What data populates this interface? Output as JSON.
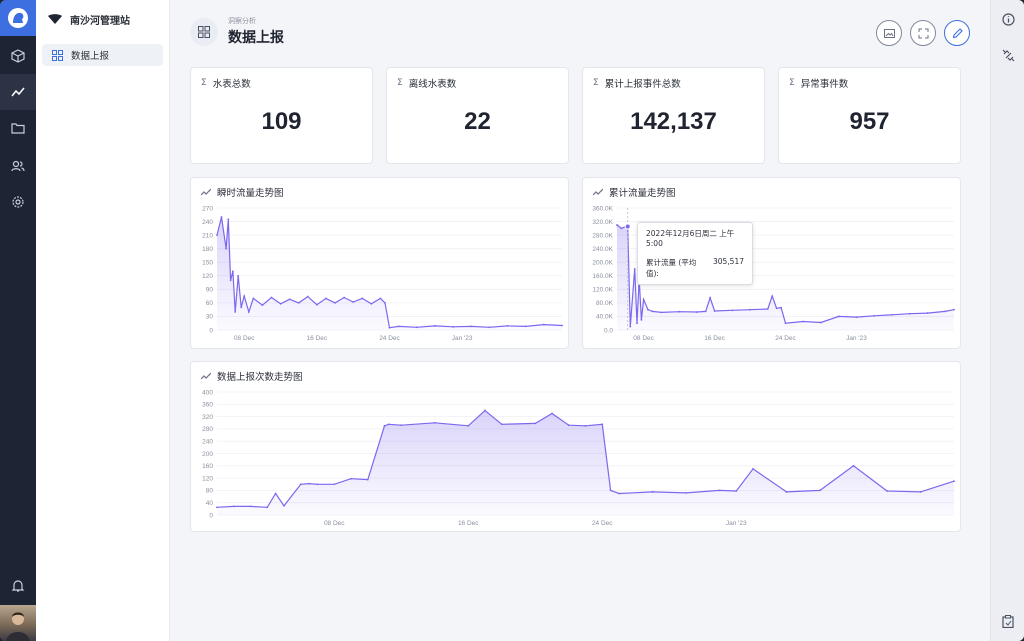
{
  "sidebar": {
    "site_name": "南沙河管理站",
    "items": [
      {
        "label": "数据上报"
      }
    ]
  },
  "header": {
    "breadcrumb": "洞察分析",
    "title": "数据上报"
  },
  "stats": [
    {
      "label": "水表总数",
      "value": "109"
    },
    {
      "label": "离线水表数",
      "value": "22"
    },
    {
      "label": "累计上报事件总数",
      "value": "142,137"
    },
    {
      "label": "异常事件数",
      "value": "957"
    }
  ],
  "colors": {
    "accent": "#7b68ee",
    "brand": "#3d6fe0",
    "rail": "#1d2433"
  },
  "tooltip": {
    "date": "2022年12月6日周二 上午5:00",
    "series": "累计流量 (平均值):",
    "value": "305,517"
  },
  "chart_data": [
    {
      "type": "area",
      "title": "瞬时流量走势图",
      "y_ticks": [
        "270",
        "240",
        "210",
        "180",
        "150",
        "120",
        "90",
        "60",
        "30",
        "0"
      ],
      "x_ticks": [
        "08 Dec",
        "16 Dec",
        "24 Dec",
        "Jan '23"
      ],
      "ylim": [
        0,
        270
      ],
      "x_range": [
        "2022-12-05",
        "2023-01-12"
      ],
      "x_tick_dates": [
        "2022-12-08",
        "2022-12-16",
        "2022-12-24",
        "2023-01-01"
      ],
      "x": [
        "2022-12-05",
        "2022-12-05T12:00",
        "2022-12-06",
        "2022-12-06T06:00",
        "2022-12-06T12:00",
        "2022-12-06T18:00",
        "2022-12-07",
        "2022-12-07T08:00",
        "2022-12-07T16:00",
        "2022-12-08",
        "2022-12-08T12:00",
        "2022-12-09",
        "2022-12-10",
        "2022-12-11",
        "2022-12-12",
        "2022-12-13",
        "2022-12-14",
        "2022-12-15",
        "2022-12-16",
        "2022-12-17",
        "2022-12-18",
        "2022-12-19",
        "2022-12-20",
        "2022-12-21",
        "2022-12-22",
        "2022-12-23",
        "2022-12-23T12:00",
        "2022-12-24",
        "2022-12-25",
        "2022-12-27",
        "2022-12-29",
        "2022-12-31",
        "2023-01-02",
        "2023-01-04",
        "2023-01-06",
        "2023-01-08",
        "2023-01-10",
        "2023-01-12"
      ],
      "values": [
        210,
        250,
        180,
        245,
        110,
        130,
        40,
        120,
        50,
        75,
        40,
        70,
        55,
        72,
        58,
        68,
        60,
        74,
        56,
        70,
        60,
        72,
        62,
        70,
        58,
        70,
        60,
        5,
        8,
        6,
        9,
        7,
        8,
        6,
        9,
        8,
        12,
        10
      ]
    },
    {
      "type": "area",
      "title": "累计流量走势图",
      "y_ticks": [
        "360.0K",
        "320.0K",
        "280.0K",
        "240.0K",
        "200.0K",
        "160.0K",
        "120.0K",
        "80.0K",
        "40.0K",
        "0.0"
      ],
      "x_ticks": [
        "08 Dec",
        "16 Dec",
        "24 Dec",
        "Jan '23"
      ],
      "ylim": [
        0,
        360000
      ],
      "x_range": [
        "2022-12-05",
        "2023-01-12"
      ],
      "x_tick_dates": [
        "2022-12-08",
        "2022-12-16",
        "2022-12-24",
        "2023-01-01"
      ],
      "x": [
        "2022-12-05",
        "2022-12-05T12:00",
        "2022-12-06",
        "2022-12-06T05:00",
        "2022-12-06T12:00",
        "2022-12-07",
        "2022-12-07T06:00",
        "2022-12-07T12:00",
        "2022-12-07T18:00",
        "2022-12-08",
        "2022-12-08T12:00",
        "2022-12-09",
        "2022-12-10",
        "2022-12-12",
        "2022-12-14",
        "2022-12-15",
        "2022-12-15T12:00",
        "2022-12-16",
        "2022-12-18",
        "2022-12-20",
        "2022-12-22",
        "2022-12-22T12:00",
        "2022-12-23",
        "2022-12-23T12:00",
        "2022-12-24",
        "2022-12-26",
        "2022-12-28",
        "2022-12-30",
        "2023-01-01",
        "2023-01-03",
        "2023-01-05",
        "2023-01-07",
        "2023-01-09",
        "2023-01-11",
        "2023-01-12"
      ],
      "values": [
        310000,
        300000,
        305000,
        305517,
        10000,
        180000,
        20000,
        150000,
        30000,
        90000,
        60000,
        55000,
        52000,
        54000,
        53000,
        55000,
        95000,
        56000,
        58000,
        60000,
        62000,
        100000,
        64000,
        66000,
        20000,
        25000,
        22000,
        40000,
        38000,
        42000,
        45000,
        48000,
        50000,
        55000,
        60000
      ]
    },
    {
      "type": "area",
      "title": "数据上报次数走势图",
      "y_ticks": [
        "400",
        "360",
        "320",
        "280",
        "240",
        "200",
        "160",
        "120",
        "80",
        "40",
        "0"
      ],
      "x_ticks": [
        "08 Dec",
        "16 Dec",
        "24 Dec",
        "Jan '23"
      ],
      "ylim": [
        0,
        400
      ],
      "x_range": [
        "2022-12-01",
        "2023-01-14"
      ],
      "x_tick_dates": [
        "2022-12-08",
        "2022-12-16",
        "2022-12-24",
        "2023-01-01"
      ],
      "x": [
        "2022-12-01",
        "2022-12-02",
        "2022-12-03",
        "2022-12-04",
        "2022-12-04T12:00",
        "2022-12-05",
        "2022-12-06",
        "2022-12-06T12:00",
        "2022-12-07",
        "2022-12-08",
        "2022-12-09",
        "2022-12-10",
        "2022-12-11",
        "2022-12-11T06:00",
        "2022-12-12",
        "2022-12-14",
        "2022-12-16",
        "2022-12-17",
        "2022-12-18",
        "2022-12-20",
        "2022-12-21",
        "2022-12-22",
        "2022-12-23",
        "2022-12-24",
        "2022-12-24T12:00",
        "2022-12-25",
        "2022-12-27",
        "2022-12-29",
        "2022-12-31",
        "2023-01-01",
        "2023-01-02",
        "2023-01-04",
        "2023-01-06",
        "2023-01-08",
        "2023-01-10",
        "2023-01-12",
        "2023-01-14"
      ],
      "values": [
        25,
        28,
        28,
        25,
        70,
        30,
        100,
        102,
        100,
        100,
        118,
        115,
        290,
        295,
        292,
        300,
        290,
        340,
        295,
        298,
        330,
        292,
        290,
        295,
        80,
        70,
        75,
        72,
        80,
        78,
        150,
        75,
        80,
        160,
        78,
        75,
        110
      ]
    }
  ]
}
